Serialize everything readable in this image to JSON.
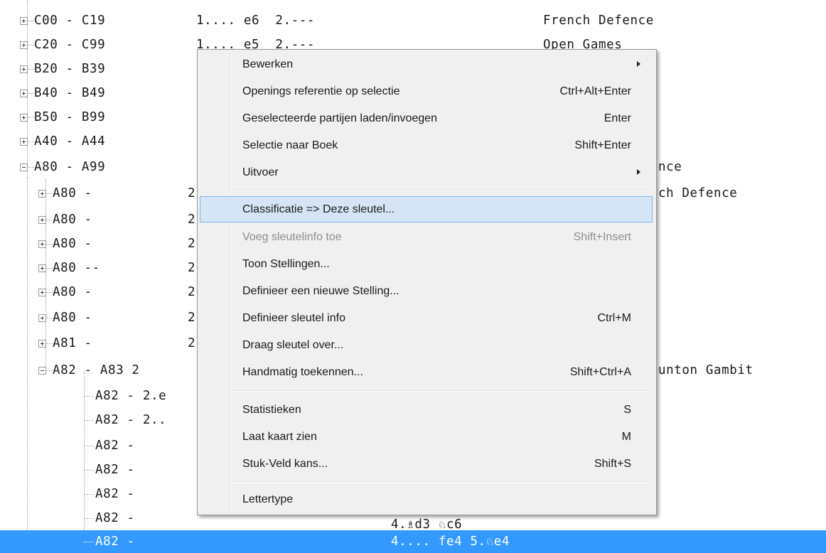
{
  "tree": {
    "rows": [
      {
        "code": "C00 - C19",
        "moves": "1.... e6  2.---",
        "name": "French Defence"
      },
      {
        "code": "C20 - C99",
        "moves": "1.... e5  2.---",
        "name": "Open Games"
      },
      {
        "code": "B20 - B39",
        "moves": "",
        "name": ""
      },
      {
        "code": "B40 - B49",
        "moves": "",
        "name": ""
      },
      {
        "code": "B50 - B99",
        "moves": "",
        "name": ""
      },
      {
        "code": "A40 - A44",
        "moves": "",
        "name": ""
      },
      {
        "code": "A80 - A99",
        "moves": "",
        "name": "nce"
      },
      {
        "code": "A80 -",
        "moves": "2",
        "name": "ch Defence"
      },
      {
        "code": "A80 -",
        "moves": "2",
        "name": ""
      },
      {
        "code": "A80 -",
        "moves": "2",
        "name": ""
      },
      {
        "code": "A80 --",
        "moves": "2",
        "name": ""
      },
      {
        "code": "A80 -",
        "moves": "2",
        "name": ""
      },
      {
        "code": "A80 -",
        "moves": "2",
        "name": ""
      },
      {
        "code": "A81 -",
        "moves": "2",
        "name": ""
      },
      {
        "code": "A82 - A83 2",
        "moves": "",
        "name": "unton Gambit"
      },
      {
        "code": "A82 - 2.e",
        "moves": "",
        "name": ""
      },
      {
        "code": "A82 - 2..",
        "moves": "",
        "name": ""
      },
      {
        "code": "A82 -",
        "moves": "",
        "name": ""
      },
      {
        "code": "A82 -",
        "moves": "",
        "name": ""
      },
      {
        "code": "A82 -",
        "moves": "",
        "name": ""
      },
      {
        "code": "A82 -",
        "moves": "4.♗d3 ♘c6",
        "name": ""
      },
      {
        "code": "A82 -",
        "moves": "4.... fe4 5.♘e4",
        "name": ""
      }
    ]
  },
  "menu": {
    "items": [
      {
        "label": "Bewerken",
        "shortcut": ""
      },
      {
        "label": "Openings referentie op selectie",
        "shortcut": "Ctrl+Alt+Enter"
      },
      {
        "label": "Geselecteerde partijen laden/invoegen",
        "shortcut": "Enter"
      },
      {
        "label": "Selectie naar Boek",
        "shortcut": "Shift+Enter"
      },
      {
        "label": "Uitvoer",
        "shortcut": ""
      },
      {
        "label": "Classificatie => Deze sleutel...",
        "shortcut": ""
      },
      {
        "label": "Voeg sleutelinfo toe",
        "shortcut": "Shift+Insert"
      },
      {
        "label": "Toon Stellingen...",
        "shortcut": ""
      },
      {
        "label": "Definieer een nieuwe Stelling...",
        "shortcut": ""
      },
      {
        "label": "Definieer sleutel info",
        "shortcut": "Ctrl+M"
      },
      {
        "label": "Draag sleutel over...",
        "shortcut": ""
      },
      {
        "label": "Handmatig toekennen...",
        "shortcut": "Shift+Ctrl+A"
      },
      {
        "label": "Statistieken",
        "shortcut": "S"
      },
      {
        "label": "Laat kaart zien",
        "shortcut": "M"
      },
      {
        "label": "Stuk-Veld kans...",
        "shortcut": "Shift+S"
      },
      {
        "label": "Lettertype",
        "shortcut": ""
      }
    ]
  },
  "colors": {
    "selection": "#3399ff",
    "menu_highlight": "#d5e5f5",
    "menu_background": "#f0f0f0",
    "disabled_text": "#8d8d8d"
  }
}
